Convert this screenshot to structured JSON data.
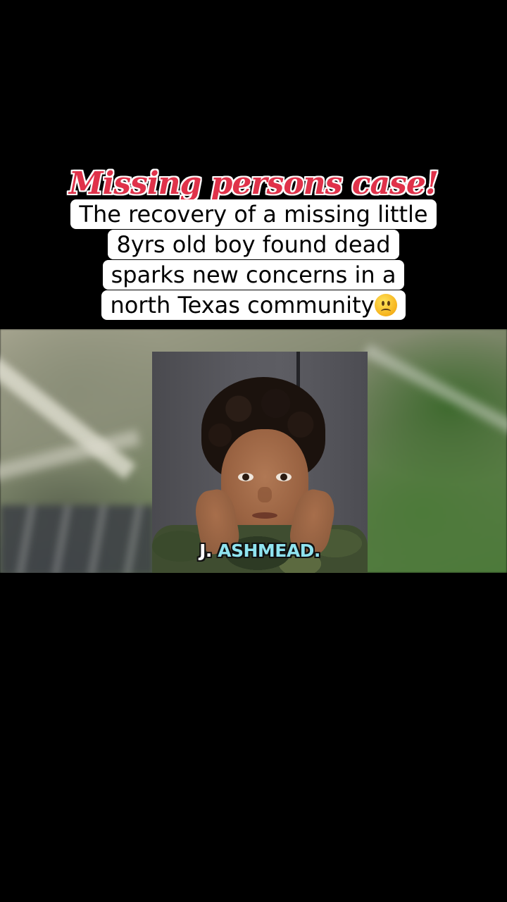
{
  "headline": {
    "title": "Missing persons case!",
    "caption_lines": [
      "The recovery of a missing little",
      "8yrs old boy found dead",
      "sparks new concerns in a",
      "north Texas community"
    ],
    "emoji": "slightly-frowning-face-icon"
  },
  "video": {
    "name_caption_initial": "J.",
    "name_caption_last": "ASHMEAD."
  },
  "colors": {
    "title_red": "#e0324a",
    "caption_bg": "#ffffff",
    "name_highlight": "#8fe3ef",
    "background": "#000000"
  }
}
